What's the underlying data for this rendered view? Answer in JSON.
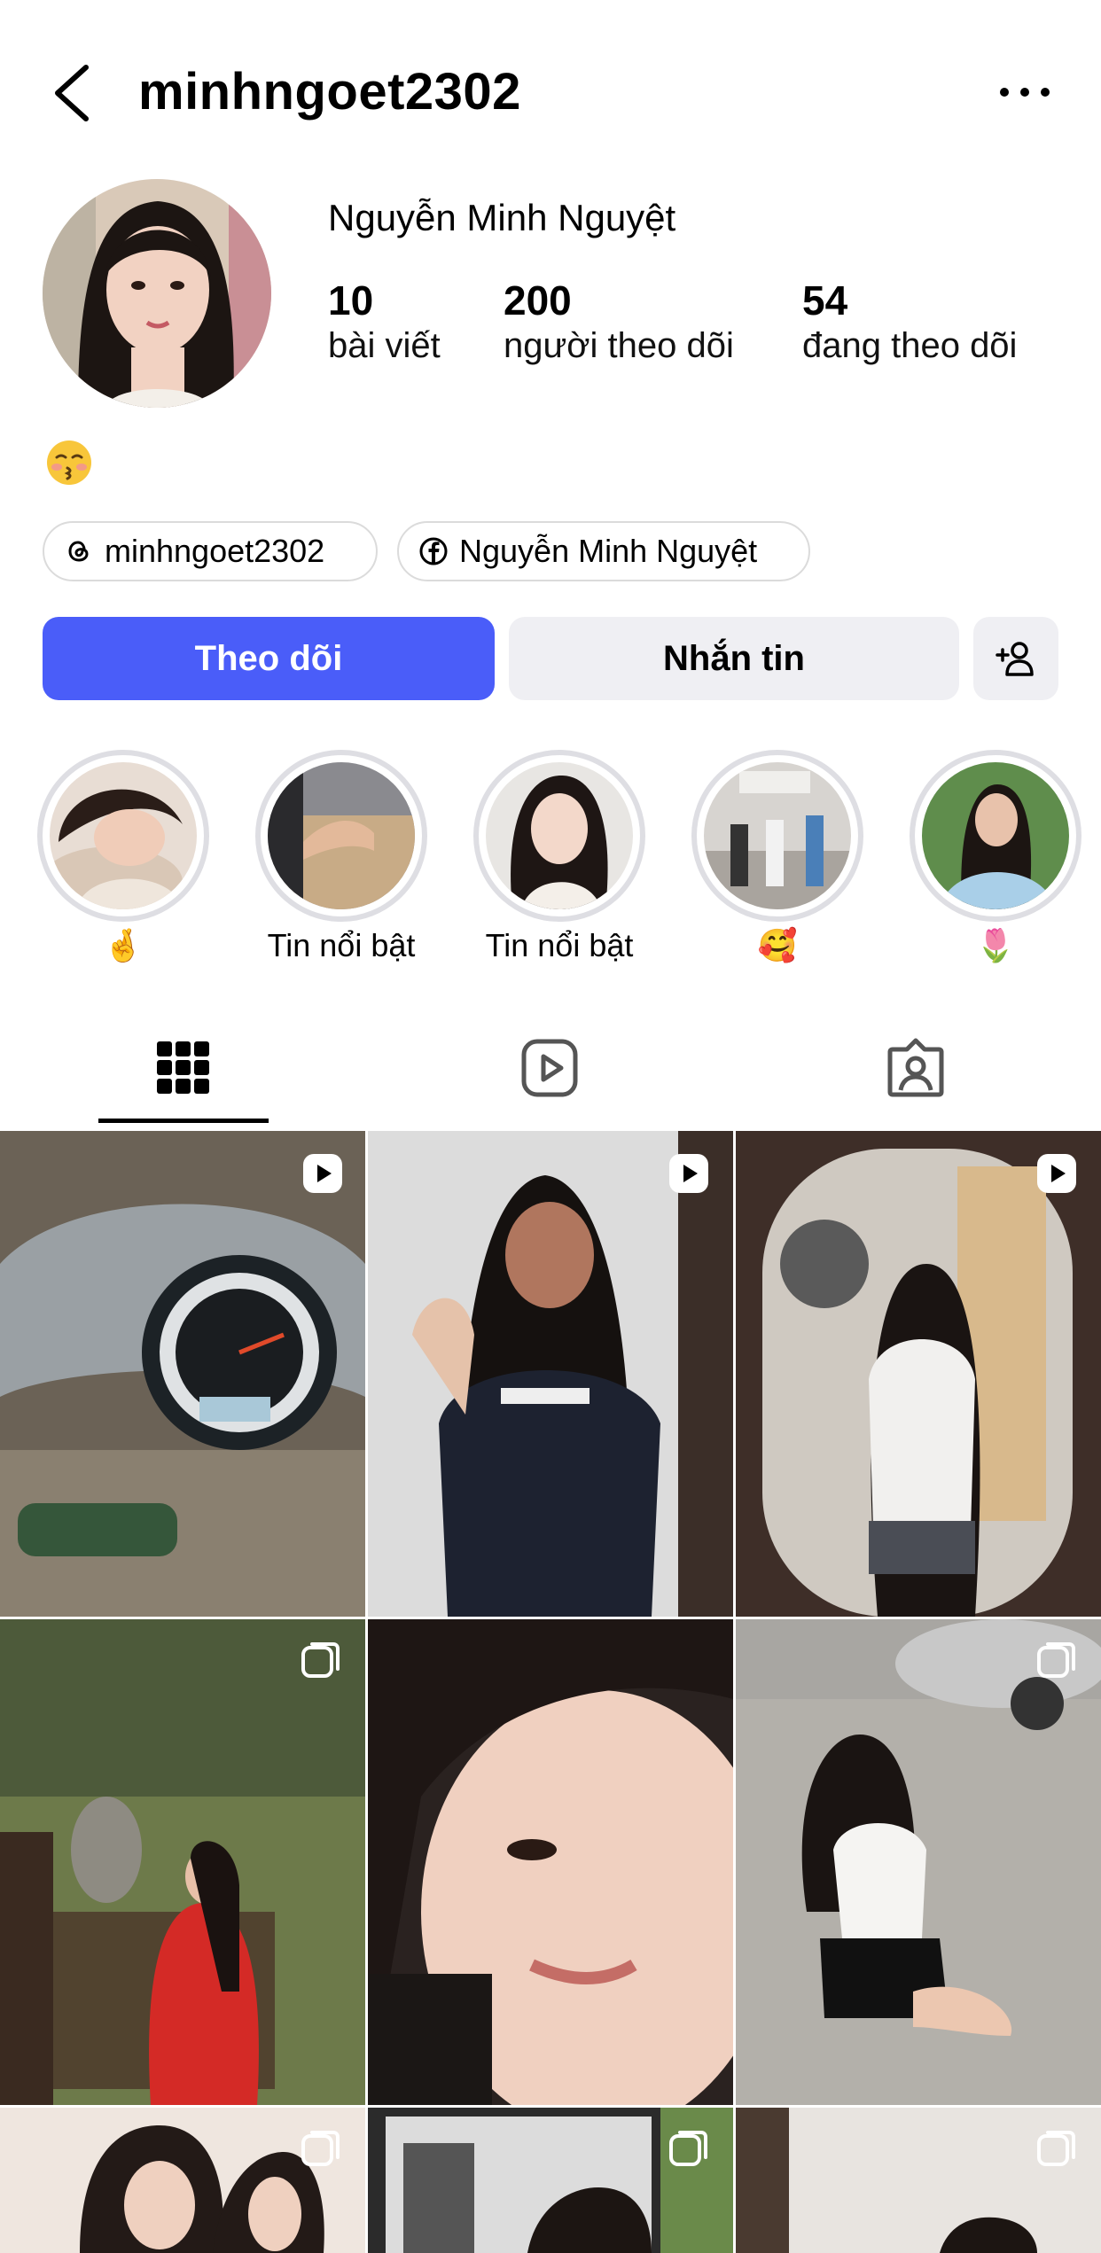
{
  "header": {
    "handle": "minhngoet2302",
    "back_icon": "chevron-left-icon",
    "more_icon": "more-horizontal-icon"
  },
  "profile": {
    "full_name": "Nguyễn Minh Nguyệt",
    "stats": [
      {
        "value": "10",
        "label": "bài viết"
      },
      {
        "value": "200",
        "label": "người theo dõi"
      },
      {
        "value": "54",
        "label": "đang theo dõi"
      }
    ],
    "bio_emoji": "kissing-face-emoji"
  },
  "links": [
    {
      "icon": "threads-icon",
      "label": "minhngoet2302"
    },
    {
      "icon": "facebook-icon",
      "label": "Nguyễn Minh Nguyệt"
    }
  ],
  "actions": {
    "follow_label": "Theo dõi",
    "message_label": "Nhắn tin",
    "suggest_icon": "add-person-icon",
    "accent": "#4a5df9"
  },
  "highlights": [
    {
      "label": "🤞"
    },
    {
      "label": "Tin nổi bật"
    },
    {
      "label": "Tin nổi bật"
    },
    {
      "label": "🥰"
    },
    {
      "label": "🌷"
    }
  ],
  "tabs": [
    {
      "icon": "grid-icon",
      "selected": true
    },
    {
      "icon": "reels-icon",
      "selected": false
    },
    {
      "icon": "tagged-icon",
      "selected": false
    }
  ],
  "posts": [
    {
      "type": "reel"
    },
    {
      "type": "reel"
    },
    {
      "type": "reel"
    },
    {
      "type": "carousel"
    },
    {
      "type": "photo"
    },
    {
      "type": "carousel"
    },
    {
      "type": "carousel"
    },
    {
      "type": "carousel"
    },
    {
      "type": "carousel"
    }
  ]
}
